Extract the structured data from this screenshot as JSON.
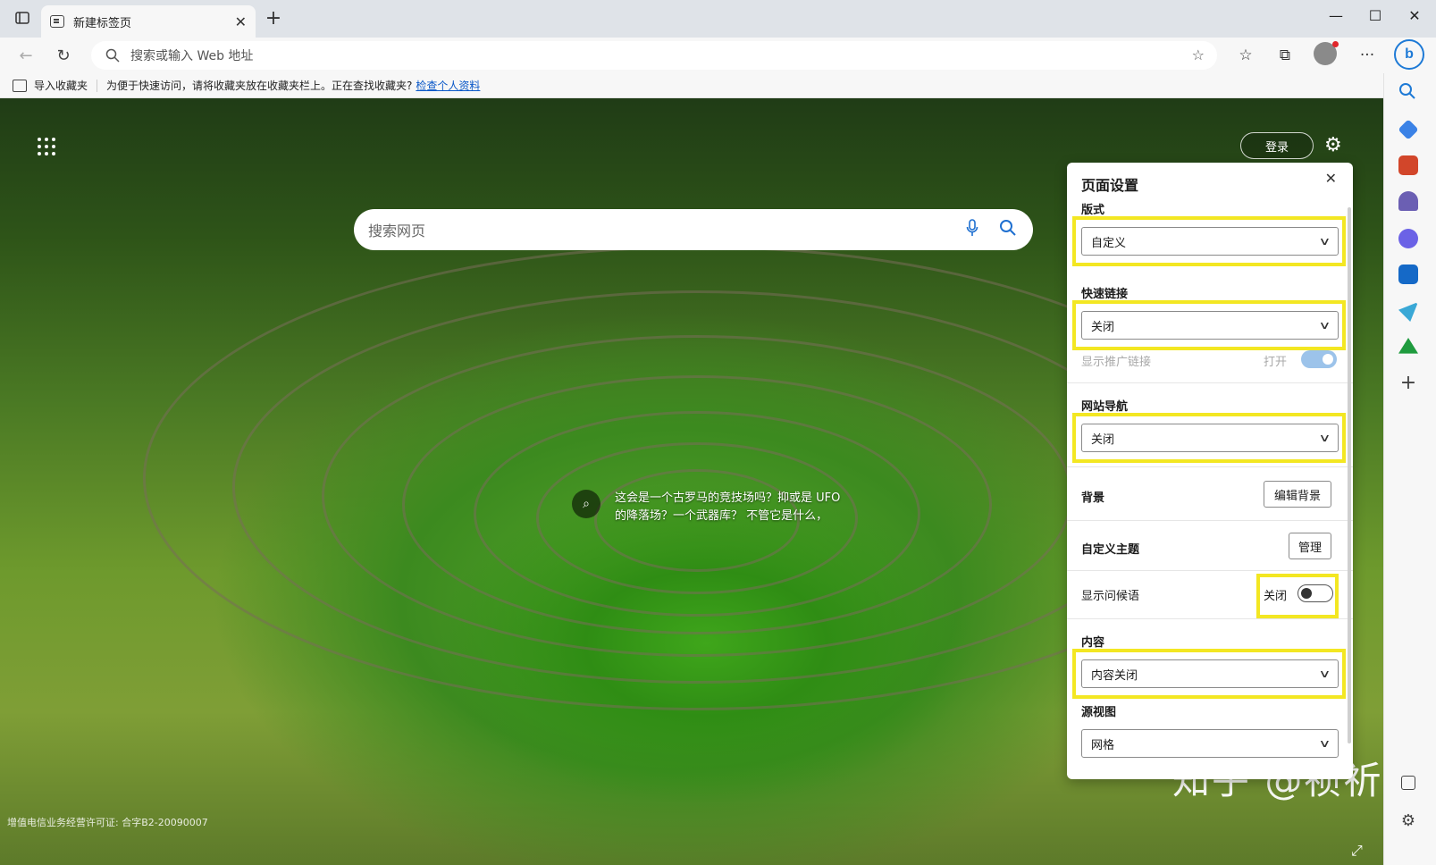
{
  "browser": {
    "tab_title": "新建标签页",
    "new_tab": "+",
    "address_placeholder": "搜索或输入 Web 地址",
    "bing_label": "b"
  },
  "favorites_bar": {
    "import_label": "导入收藏夹",
    "message": "为便于快速访问，请将收藏夹放在收藏夹栏上。正在查找收藏夹?",
    "link": "检查个人资料"
  },
  "page": {
    "login_label": "登录",
    "search_placeholder": "搜索网页",
    "caption": "这会是一个古罗马的竞技场吗？抑或是 UFO 的降落场？一个武器库？ 不管它是什么，",
    "license": "增值电信业务经营许可证: 合字B2-20090007",
    "watermark": "知乎 @祯祈"
  },
  "settings": {
    "title": "页面设置",
    "layout_label": "版式",
    "layout_value": "自定义",
    "quicklinks_label": "快速链接",
    "quicklinks_value": "关闭",
    "promo_label": "显示推广链接",
    "promo_state": "打开",
    "sitenav_label": "网站导航",
    "sitenav_value": "关闭",
    "background_label": "背景",
    "background_button": "编辑背景",
    "theme_label": "自定义主题",
    "theme_button": "管理",
    "greeting_label": "显示问候语",
    "greeting_state": "关闭",
    "content_label": "内容",
    "content_value": "内容关闭",
    "view_label": "源视图",
    "view_value": "网格"
  },
  "colors": {
    "highlight": "#f3e722",
    "accent": "#1e7ad6",
    "toggle_on": "#9cc3ea"
  }
}
